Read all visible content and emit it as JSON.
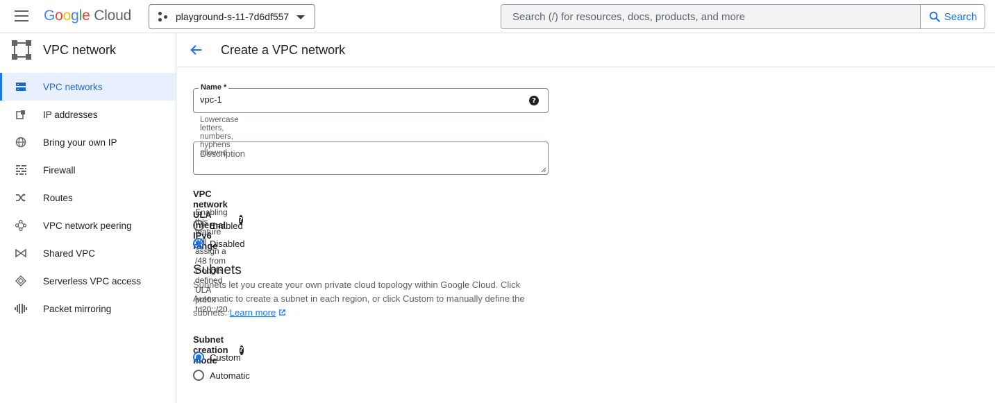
{
  "topbar": {
    "logo": {
      "G": "G",
      "o1": "o",
      "o2": "o",
      "g": "g",
      "l": "l",
      "e": "e",
      "cloud": "Cloud"
    },
    "project_name": "playground-s-11-7d6df557",
    "search_placeholder": "Search (/) for resources, docs, products, and more",
    "search_button": "Search"
  },
  "sidebar": {
    "product_title": "VPC network",
    "items": [
      {
        "label": "VPC networks",
        "icon": "vpc-networks-icon",
        "active": true
      },
      {
        "label": "IP addresses",
        "icon": "ip-addresses-icon"
      },
      {
        "label": "Bring your own IP",
        "icon": "globe-icon"
      },
      {
        "label": "Firewall",
        "icon": "firewall-icon"
      },
      {
        "label": "Routes",
        "icon": "routes-icon"
      },
      {
        "label": "VPC network peering",
        "icon": "peering-icon"
      },
      {
        "label": "Shared VPC",
        "icon": "shared-vpc-icon"
      },
      {
        "label": "Serverless VPC access",
        "icon": "serverless-icon"
      },
      {
        "label": "Packet mirroring",
        "icon": "packet-mirroring-icon"
      }
    ]
  },
  "main": {
    "title": "Create a VPC network",
    "name_field": {
      "label": "Name *",
      "value": "vpc-1",
      "hint": "Lowercase letters, numbers, hyphens allowed"
    },
    "description_field": {
      "placeholder": "Description"
    },
    "ula": {
      "label": "VPC network ULA internal IPv6 range",
      "description": "Enabling this feature will assign a /48 from Google defined ULA prefix fd20::/20.",
      "options": [
        "Enabled",
        "Disabled"
      ],
      "selected": "Disabled"
    },
    "subnets": {
      "heading": "Subnets",
      "text": "Subnets let you create your own private cloud topology within Google Cloud. Click Automatic to create a subnet in each region, or click Custom to manually define the subnets.",
      "learn_more": "Learn more"
    },
    "subnet_mode": {
      "label": "Subnet creation mode",
      "options": [
        "Custom",
        "Automatic"
      ],
      "selected": "Custom"
    }
  },
  "colors": {
    "accent": "#1a73e8",
    "active_bg": "#e8f0fe",
    "border": "#dadce0"
  }
}
